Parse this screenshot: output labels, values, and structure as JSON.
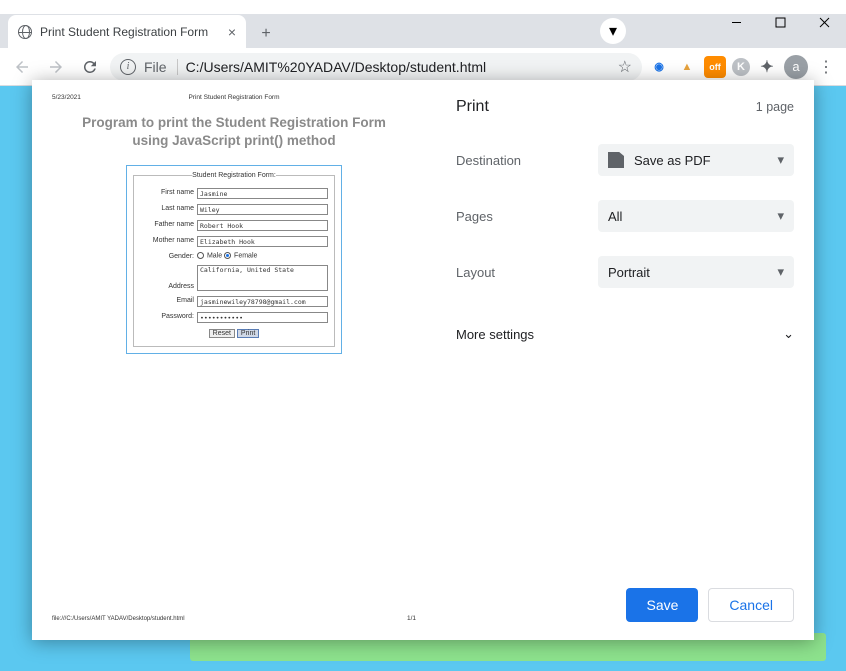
{
  "window": {
    "tab_title": "Print Student Registration Form",
    "url_prefix": "File",
    "url": "C:/Users/AMIT%20YADAV/Desktop/student.html",
    "avatar_letter": "a"
  },
  "preview": {
    "date": "5/23/2021",
    "header": "Print Student Registration Form",
    "title_line1": "Program to print the Student Registration Form",
    "title_line2": "using JavaScript print() method",
    "legend": "Student Registration Form:",
    "rows": {
      "first_name_lbl": "First name",
      "first_name": "Jasmine",
      "last_name_lbl": "Last name",
      "last_name": "Wiley",
      "father_lbl": "Father name",
      "father": "Robert Hook",
      "mother_lbl": "Mother name",
      "mother": "Elizabeth Hook",
      "gender_lbl": "Gender:",
      "male": "Male",
      "female": "Female",
      "address_lbl": "Address",
      "address": "California, United State",
      "email_lbl": "Email",
      "email": "jasminewiley78798@gmail.com",
      "password_lbl": "Password:",
      "password": "•••••••••••",
      "reset": "Reset",
      "print": "Print"
    },
    "foot_left": "file:///C:/Users/AMIT YADAV/Desktop/student.html",
    "foot_right": "1/1"
  },
  "print": {
    "title": "Print",
    "page_count": "1 page",
    "dest_label": "Destination",
    "dest_value": "Save as PDF",
    "pages_label": "Pages",
    "pages_value": "All",
    "layout_label": "Layout",
    "layout_value": "Portrait",
    "more": "More settings",
    "save": "Save",
    "cancel": "Cancel"
  }
}
